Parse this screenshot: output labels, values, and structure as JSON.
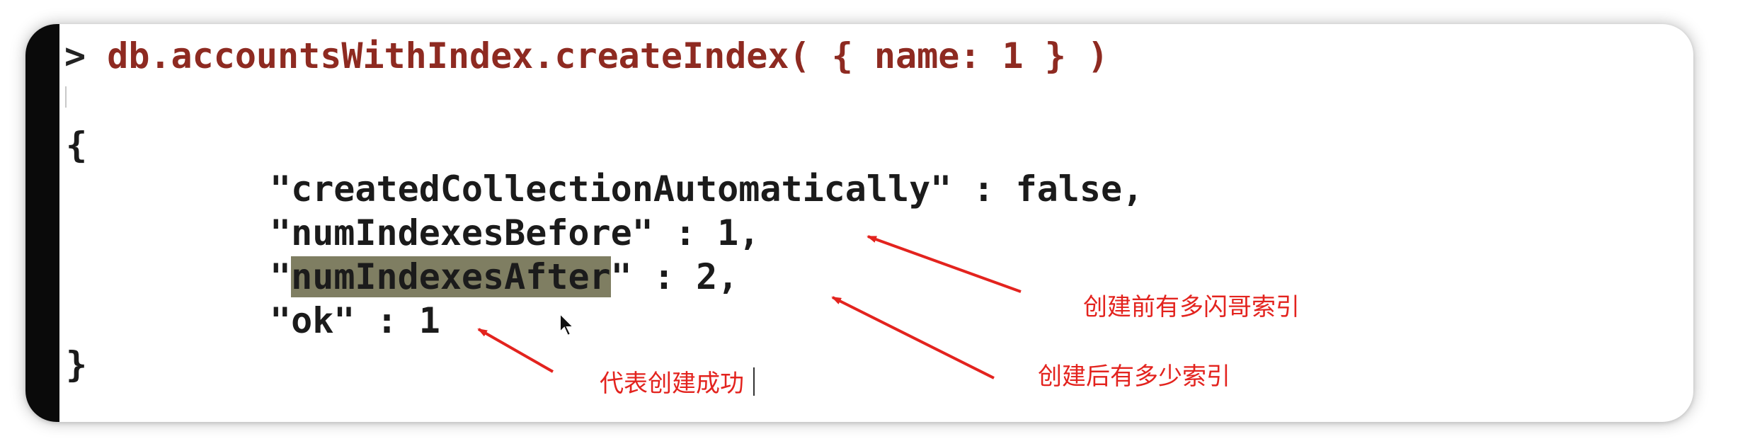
{
  "terminal": {
    "prompt": ">",
    "command": "db.accountsWithIndex.createIndex( { name: 1 } )",
    "result": {
      "open_brace": "{",
      "line1": "\"createdCollectionAutomatically\" : false,",
      "line2": "\"numIndexesBefore\" : 1,",
      "line3_prefix": "\"",
      "line3_highlight": "numIndexesAfter",
      "line3_suffix": "\" : 2,",
      "line4": "\"ok\" : 1",
      "close_brace": "}"
    }
  },
  "annotations": {
    "before": "创建前有多闪哥索引",
    "after": "创建后有多少索引",
    "ok": "代表创建成功"
  },
  "colors": {
    "command": "#8e2a21",
    "annotation": "#e3231e",
    "highlight": "#7f7e62",
    "gutter": "#0a0a0a"
  }
}
